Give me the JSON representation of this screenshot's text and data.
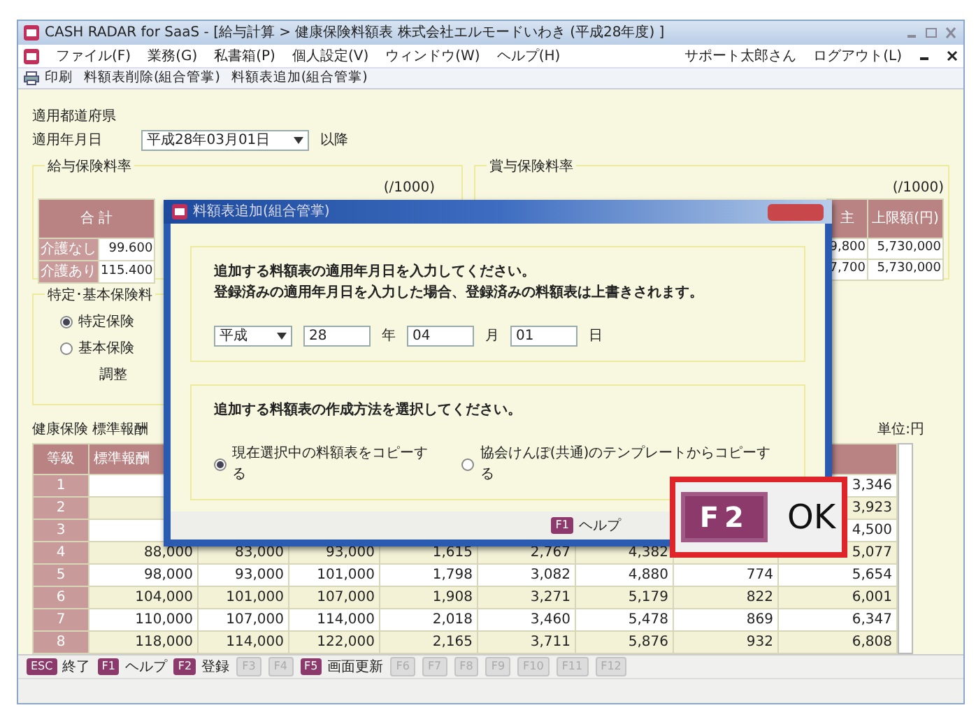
{
  "window": {
    "title": "CASH RADAR for SaaS - [給与計算 > 健康保険料額表 株式会社エルモードいわき (平成28年度) ]"
  },
  "menu": [
    {
      "label": "ファイル(F)"
    },
    {
      "label": "業務(G)"
    },
    {
      "label": "私書箱(P)"
    },
    {
      "label": "個人設定(V)"
    },
    {
      "label": "ウィンドウ(W)"
    },
    {
      "label": "ヘルプ(H)"
    }
  ],
  "user": {
    "name": "サポート太郎さん",
    "logout": "ログアウト(L)"
  },
  "toolbar": [
    {
      "label": "印刷",
      "kind": "icon"
    },
    {
      "label": "料額表削除(組合管掌)",
      "kind": "text"
    },
    {
      "label": "料額表追加(組合管掌)",
      "kind": "text"
    }
  ],
  "settings": {
    "prefecture_label": "適用都道府県",
    "date_label": "適用年月日",
    "date_value": "平成28年03月01日",
    "date_suffix": "以降"
  },
  "salary_rate": {
    "title": "給与保険料率",
    "unit": "(/1000)",
    "header": "合 計",
    "rows": [
      {
        "label": "介護なし",
        "value": "99.600"
      },
      {
        "label": "介護あり",
        "value": "115.400"
      }
    ]
  },
  "bonus_rate": {
    "title": "賞与保険料率",
    "unit": "(/1000)",
    "columns": [
      "主",
      "上限額(円)"
    ],
    "rows": [
      [
        "9,800",
        "5,730,000"
      ],
      [
        "7,700",
        "5,730,000"
      ]
    ]
  },
  "premium_type": {
    "title": "特定･基本保険料",
    "options": [
      {
        "label": "特定保険",
        "selected": true
      },
      {
        "label": "基本保険",
        "selected": false
      }
    ],
    "note": "調整"
  },
  "table": {
    "title": "健康保険 標準報酬",
    "unit": "単位:円",
    "columns": [
      "等級",
      "標準報酬",
      null,
      null,
      null,
      null,
      null,
      null,
      null
    ],
    "rows": [
      {
        "cells": [
          "1",
          null,
          null,
          null,
          null,
          null,
          null,
          null,
          "3,346"
        ]
      },
      {
        "cells": [
          "2",
          null,
          null,
          null,
          null,
          null,
          null,
          null,
          "3,923"
        ]
      },
      {
        "cells": [
          "3",
          null,
          null,
          null,
          null,
          null,
          null,
          null,
          "4,500"
        ]
      },
      {
        "cells": [
          "4",
          "88,000",
          "83,000",
          "93,000",
          "1,615",
          "2,767",
          "4,382",
          null,
          "5,077"
        ]
      },
      {
        "cells": [
          "5",
          "98,000",
          "93,000",
          "101,000",
          "1,798",
          "3,082",
          "4,880",
          "774",
          "5,654"
        ]
      },
      {
        "cells": [
          "6",
          "104,000",
          "101,000",
          "107,000",
          "1,908",
          "3,271",
          "5,179",
          "822",
          "6,001"
        ]
      },
      {
        "cells": [
          "7",
          "110,000",
          "107,000",
          "114,000",
          "2,018",
          "3,460",
          "5,478",
          "869",
          "6,347"
        ]
      },
      {
        "cells": [
          "8",
          "118,000",
          "114,000",
          "122,000",
          "2,165",
          "3,711",
          "5,876",
          "932",
          "6,808"
        ]
      }
    ]
  },
  "function_keys": [
    {
      "key": "ESC",
      "label": "終了",
      "disabled": false
    },
    {
      "key": "F1",
      "label": "ヘルプ",
      "disabled": false
    },
    {
      "key": "F2",
      "label": "登録",
      "disabled": false
    },
    {
      "key": "F3",
      "disabled": true
    },
    {
      "key": "F4",
      "disabled": true
    },
    {
      "key": "F5",
      "label": "画面更新",
      "disabled": false
    },
    {
      "key": "F6",
      "disabled": true
    },
    {
      "key": "F7",
      "disabled": true
    },
    {
      "key": "F8",
      "disabled": true
    },
    {
      "key": "F9",
      "disabled": true
    },
    {
      "key": "F10",
      "disabled": true
    },
    {
      "key": "F11",
      "disabled": true
    },
    {
      "key": "F12",
      "disabled": true
    }
  ],
  "dialog": {
    "title": "料額表追加(組合管掌)",
    "instruction": [
      "追加する料額表の適用年月日を入力してください。",
      "登録済みの適用年月日を入力した場合、登録済みの料額表は上書きされます。"
    ],
    "era": "平成",
    "year": "28",
    "year_unit": "年",
    "month": "04",
    "month_unit": "月",
    "day": "01",
    "day_unit": "日",
    "method_prompt": "追加する料額表の作成方法を選択してください。",
    "methods": [
      {
        "label": "現在選択中の料額表をコピーする",
        "selected": true
      },
      {
        "label": "協会けんぽ(共通)のテンプレートからコピーする",
        "selected": false
      }
    ],
    "help_key": "F1",
    "help_label": "ヘルプ"
  },
  "callout": {
    "key": "F2",
    "label": "OK"
  }
}
